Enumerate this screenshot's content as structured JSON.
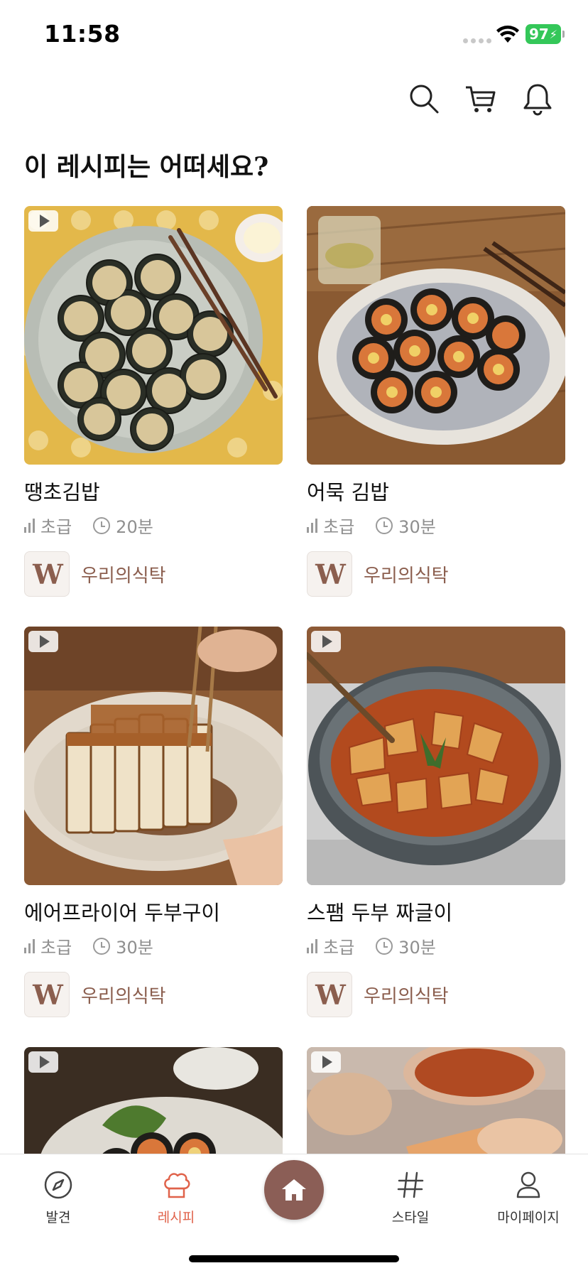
{
  "status_bar": {
    "time": "11:58",
    "battery": "97"
  },
  "section_title": "이 레시피는 어떠세요?",
  "recipes": [
    {
      "title": "땡초김밥",
      "level": "초급",
      "time": "20분",
      "author": "우리의식탁",
      "author_logo": "W",
      "has_video": true
    },
    {
      "title": "어묵 김밥",
      "level": "초급",
      "time": "30분",
      "author": "우리의식탁",
      "author_logo": "W",
      "has_video": false
    },
    {
      "title": "에어프라이어 두부구이",
      "level": "초급",
      "time": "30분",
      "author": "우리의식탁",
      "author_logo": "W",
      "has_video": true
    },
    {
      "title": "스팸 두부 짜글이",
      "level": "초급",
      "time": "30분",
      "author": "우리의식탁",
      "author_logo": "W",
      "has_video": true
    },
    {
      "has_video": true
    },
    {
      "has_video": true
    }
  ],
  "tab_bar": {
    "discover": "발견",
    "recipe": "레시피",
    "style": "스타일",
    "mypage": "마이페이지"
  },
  "colors": {
    "accent": "#e0624a",
    "brand_brown": "#8b5e56",
    "battery_green": "#34c759"
  },
  "icons": [
    "search-icon",
    "cart-icon",
    "bell-icon",
    "play-icon",
    "compass-icon",
    "chef-hat-icon",
    "home-icon",
    "hashtag-icon",
    "person-icon"
  ]
}
